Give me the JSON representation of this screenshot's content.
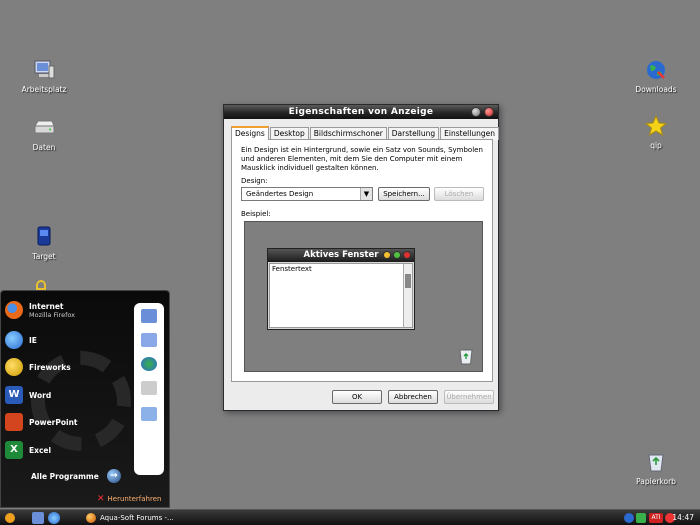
{
  "desktop": {
    "icons_left": [
      {
        "label": "Arbeitsplatz",
        "icon": "computer-icon"
      },
      {
        "label": "Daten",
        "icon": "drive-icon"
      },
      {
        "label": "Target",
        "icon": "target-icon"
      }
    ],
    "icons_right": [
      {
        "label": "Downloads",
        "icon": "globe-icon"
      },
      {
        "label": "qip",
        "icon": "star-icon"
      },
      {
        "label": "Papierkorb",
        "icon": "recycle-bin-icon"
      }
    ]
  },
  "dialog": {
    "title": "Eigenschaften von Anzeige",
    "tabs": [
      "Designs",
      "Desktop",
      "Bildschirmschoner",
      "Darstellung",
      "Einstellungen"
    ],
    "active_tab": "Designs",
    "description": "Ein Design ist ein Hintergrund, sowie ein Satz von Sounds, Symbolen und anderen Elementen, mit dem Sie den Computer mit einem Mausklick individuell gestalten können.",
    "design_label": "Design:",
    "design_value": "Geändertes Design",
    "save_button": "Speichern...",
    "delete_button": "Löschen",
    "preview_label": "Beispiel:",
    "preview_window_title": "Aktives Fenster",
    "preview_window_text": "Fenstertext",
    "ok_button": "OK",
    "cancel_button": "Abbrechen",
    "apply_button": "Übernehmen"
  },
  "start_menu": {
    "items": [
      {
        "label": "Internet",
        "sub": "Mozilla Firefox",
        "icon": "firefox-icon",
        "color": "#e86a1a"
      },
      {
        "label": "IE",
        "sub": "",
        "icon": "ie-icon",
        "color": "#3a7fd8"
      },
      {
        "label": "Fireworks",
        "sub": "",
        "icon": "fireworks-icon",
        "color": "#e3b21a"
      },
      {
        "label": "Word",
        "sub": "",
        "icon": "word-icon",
        "color": "#2a5bb8"
      },
      {
        "label": "PowerPoint",
        "sub": "",
        "icon": "powerpoint-icon",
        "color": "#d2451e"
      },
      {
        "label": "Excel",
        "sub": "",
        "icon": "excel-icon",
        "color": "#1f8a3a"
      }
    ],
    "all_programs": "Alle Programme",
    "shutdown": "Herunterfahren"
  },
  "taskbar": {
    "task_label": "Aqua-Soft Forums -...",
    "clock": "14:47"
  }
}
